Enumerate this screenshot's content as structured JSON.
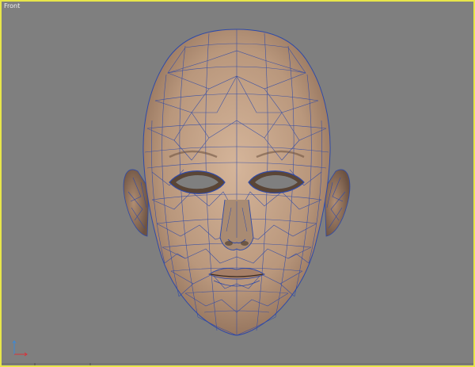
{
  "viewport": {
    "label": "Front",
    "border_color": "#e7e64a",
    "background_color": "#7f7f7f"
  },
  "model": {
    "skin_color": "#c7a58a",
    "wire_color": "#2f4aa8"
  },
  "gizmo": {
    "x_axis_color": "#d8333a",
    "z_axis_color": "#3a8ad8"
  }
}
